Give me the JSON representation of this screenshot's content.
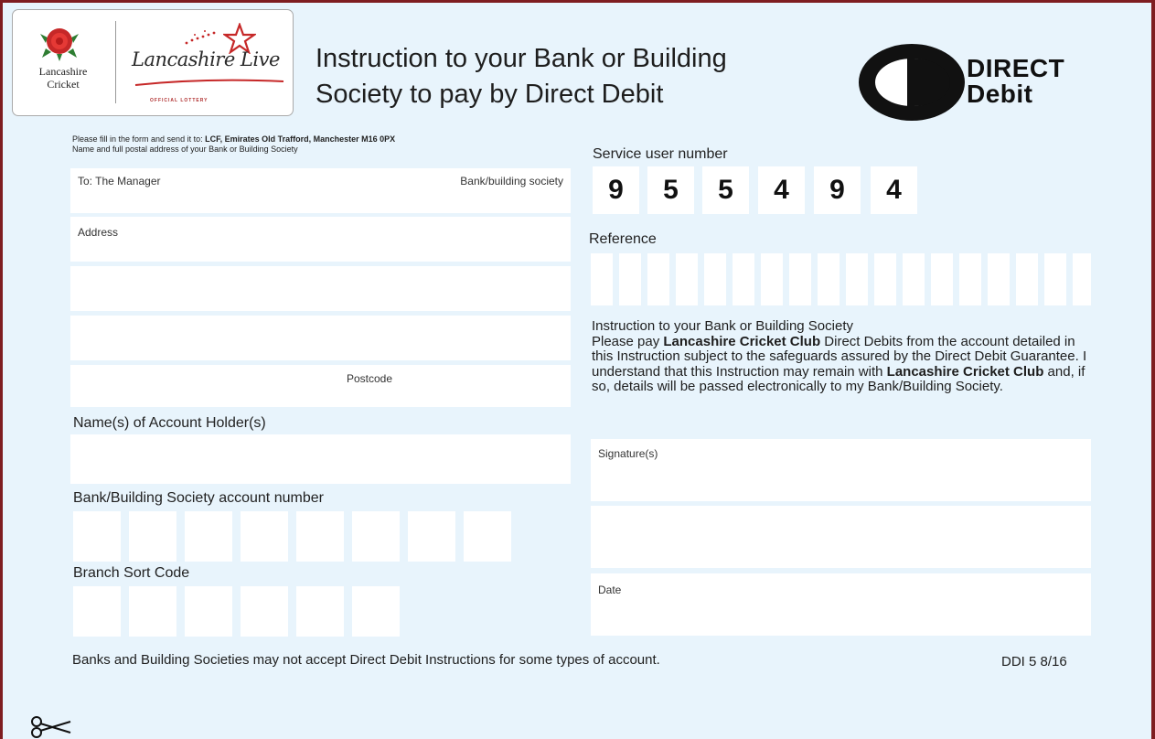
{
  "header": {
    "logo_lcc_line1": "Lancashire",
    "logo_lcc_line2": "Cricket",
    "logo_lotto": "Lancashire Live",
    "logo_lotto_sub": "OFFICIAL LOTTERY",
    "title_line1": "Instruction to your Bank or Building",
    "title_line2": "Society to pay by Direct Debit",
    "dd_logo_line1": "DIRECT",
    "dd_logo_line2": "Debit"
  },
  "left": {
    "send_to_prefix": "Please fill in the form and send it to: ",
    "send_to_address": "LCF, Emirates Old Trafford, Manchester M16 0PX",
    "bank_address_caption": "Name and full postal address of your Bank or Building Society",
    "to_manager": "To: The Manager",
    "bank_building_society": "Bank/building society",
    "address_label": "Address",
    "postcode_label": "Postcode",
    "account_holder_label": "Name(s) of Account Holder(s)",
    "account_number_label": "Bank/Building Society account number",
    "sort_code_label": "Branch Sort Code"
  },
  "right": {
    "service_user_label": "Service user number",
    "service_user_digits": [
      "9",
      "5",
      "5",
      "4",
      "9",
      "4"
    ],
    "reference_label": "Reference",
    "instruction_heading": "Instruction to your Bank or Building Society",
    "instruction_p1": "Please pay ",
    "instruction_company": "Lancashire Cricket Club",
    "instruction_p2": " Direct Debits from the account detailed in this Instruction subject to the safeguards assured by the Direct Debit Guarantee. I understand that this Instruction may remain with ",
    "instruction_company2": "Lancashire Cricket Club",
    "instruction_p3": " and, if so, details will be passed electronically to my Bank/Building Society.",
    "signature_label": "Signature(s)",
    "date_label": "Date"
  },
  "footer": {
    "note": "Banks and Building Societies may not accept Direct Debit Instructions for some types of account.",
    "code": "DDI 5 8/16"
  },
  "icons": [
    "rose-icon",
    "star-icon",
    "direct-debit-logo-icon",
    "scissors-icon"
  ],
  "colors": {
    "frame": "#7e1d20",
    "form_bg": "#e8f4fc",
    "field": "#ffffff"
  }
}
